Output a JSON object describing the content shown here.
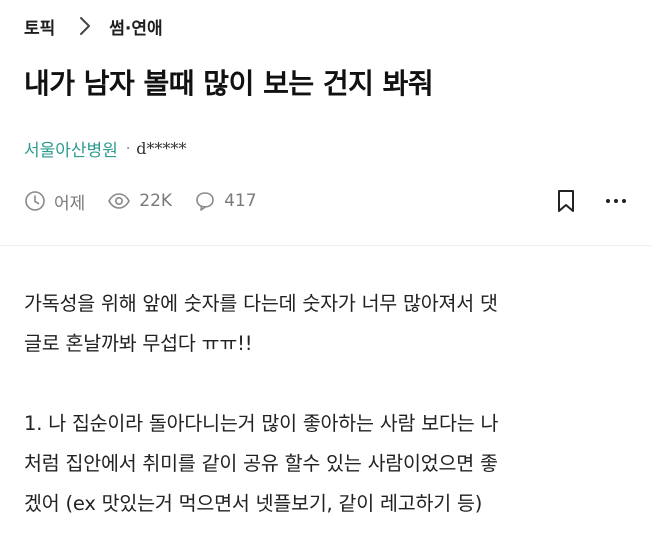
{
  "breadcrumb": {
    "root": "토픽",
    "current": "썸·연애"
  },
  "post": {
    "title": "내가 남자 볼때 많이 보는 건지 봐줘",
    "company": "서울아산병원",
    "separator": "·",
    "nickname": "d*****",
    "time": "어제",
    "views": "22K",
    "comments": "417"
  },
  "icons": {
    "chevron": "chevron-right-icon",
    "clock": "clock-icon",
    "eye": "eye-icon",
    "comment": "comment-bubble-icon",
    "bookmark": "bookmark-icon",
    "more": "more-horizontal-icon"
  },
  "colors": {
    "company": "#2e9b8f",
    "meta": "#7a7a7a",
    "text": "#222222"
  },
  "body": {
    "p1": [
      "가독성을 위해 앞에 숫자를 다는데 숫자가 너무 많아져서 댓",
      "글로 혼날까봐 무섭다 ㅠㅠ!!"
    ],
    "p2": [
      "1. 나 집순이라 돌아다니는거 많이 좋아하는 사람 보다는 나",
      "처럼 집안에서 취미를 같이 공유 할수 있는 사람이었으면 좋",
      "겠어 (ex 맛있는거 먹으면서 넷플보기, 같이 레고하기 등)"
    ]
  }
}
